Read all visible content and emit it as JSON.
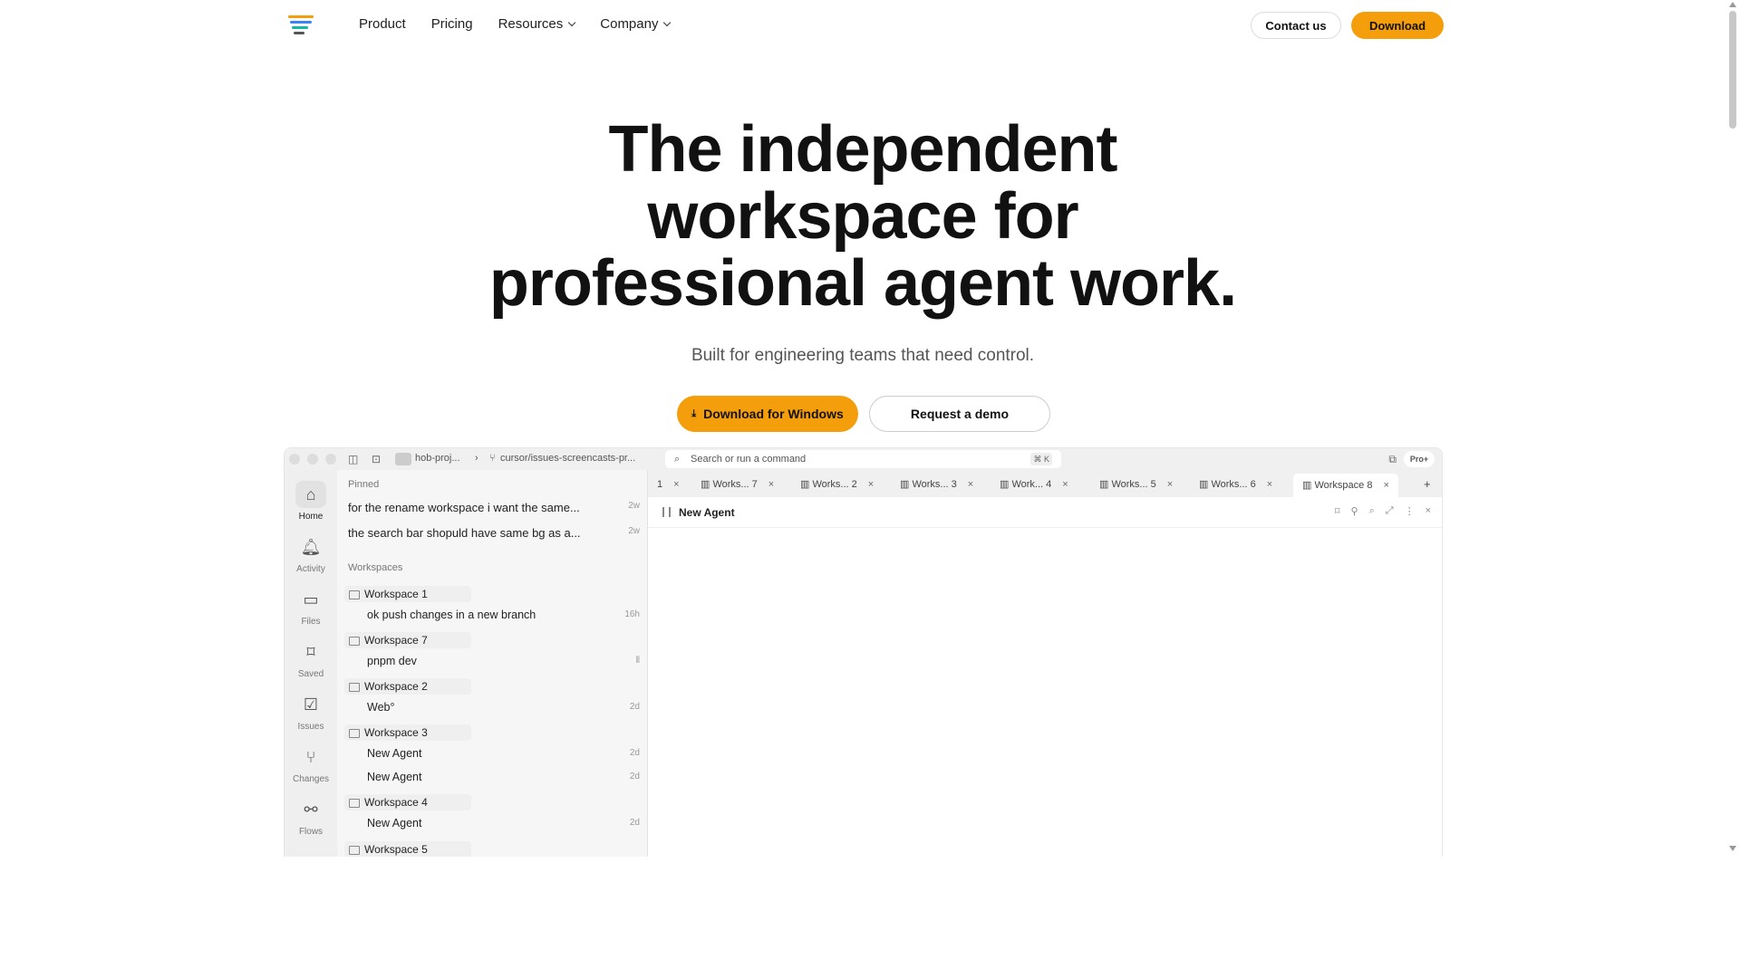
{
  "nav": {
    "links": [
      "Product",
      "Pricing",
      "Resources",
      "Company"
    ],
    "contact_label": "Contact us",
    "download_label": "Download"
  },
  "hero": {
    "title_lines": [
      "The independent",
      "workspace for",
      "professional agent work."
    ],
    "subtitle": "Built for engineering teams that need control.",
    "primary_cta": "Download for Windows",
    "secondary_cta": "Request a demo"
  },
  "app": {
    "breadcrumb_project": "hob-proj...",
    "breadcrumb_branch": "cursor/issues-screencasts-pr...",
    "command_placeholder": "Search or run a command",
    "command_shortcut": "⌘ K",
    "plan_badge": "Pro+",
    "rail": [
      "Home",
      "Activity",
      "Files",
      "Saved",
      "Issues",
      "Changes",
      "Flows"
    ],
    "pinned_label": "Pinned",
    "pinned": [
      {
        "text": "for the rename workspace i want the same...",
        "time": "2w"
      },
      {
        "text": "the search bar shopuld have same bg as a...",
        "time": "2w"
      }
    ],
    "workspaces_label": "Workspaces",
    "workspaces": [
      {
        "name": "Workspace 1",
        "items": [
          {
            "text": "ok push changes in a new branch",
            "time": "16h"
          }
        ]
      },
      {
        "name": "Workspace 7",
        "items": [
          {
            "text": "pnpm dev",
            "time": "⦀"
          }
        ]
      },
      {
        "name": "Workspace 2",
        "items": [
          {
            "text": "Web°",
            "time": "2d"
          }
        ]
      },
      {
        "name": "Workspace 3",
        "items": [
          {
            "text": "New Agent",
            "time": "2d"
          },
          {
            "text": "New Agent",
            "time": "2d"
          }
        ]
      },
      {
        "name": "Workspace 4",
        "items": [
          {
            "text": "New Agent",
            "time": "2d"
          }
        ]
      },
      {
        "name": "Workspace 5",
        "items": []
      }
    ],
    "tabs": [
      "1",
      "Works... 7",
      "Works... 2",
      "Works... 3",
      "Work... 4",
      "Works... 5",
      "Works... 6",
      "Workspace 8"
    ],
    "active_tab": "Workspace 8",
    "agent_title": "New Agent"
  },
  "colors": {
    "accent": "#f59e0b"
  }
}
